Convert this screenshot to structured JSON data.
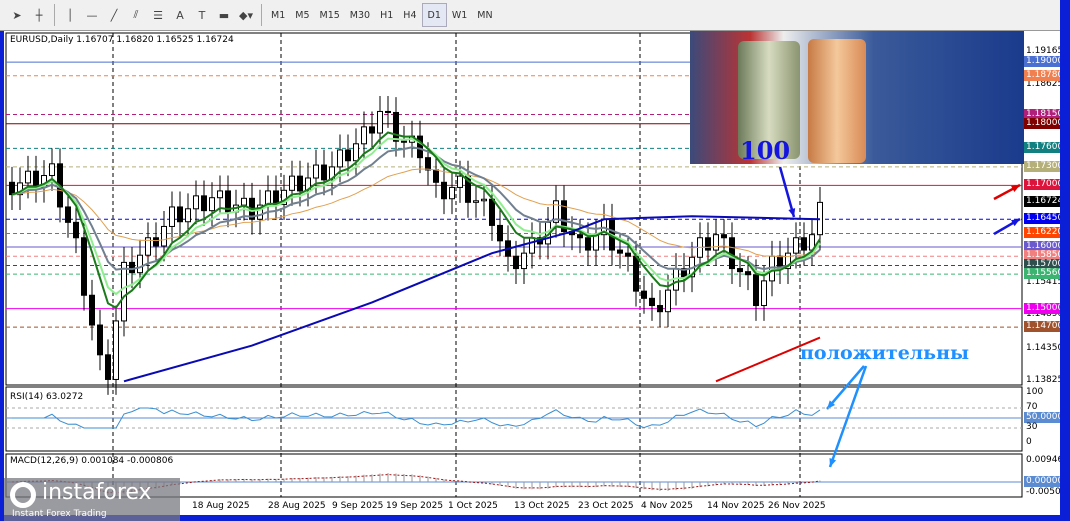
{
  "toolbar": {
    "tools": [
      "cursor",
      "crosshair",
      "vertical-line",
      "horizontal-line",
      "trendline",
      "equidistant-channel",
      "fibonacci",
      "text",
      "text-label",
      "rectangle",
      "shapes-menu"
    ],
    "text_tool": "A",
    "timeframes": [
      "M1",
      "M5",
      "M15",
      "M30",
      "H1",
      "H4",
      "D1",
      "W1",
      "MN"
    ],
    "active_timeframe": "D1"
  },
  "chart": {
    "header": "EURUSD,Daily  1.16707 1.16820 1.16525 1.16724",
    "price_ticks": [
      "1.19165",
      "1.18625",
      "1.15415",
      "1.14890",
      "1.14350",
      "1.13825"
    ],
    "levels": [
      {
        "label": "1.19000",
        "value": 1.19,
        "color": "#4a6fd0",
        "style": "solid"
      },
      {
        "label": "1.18780",
        "value": 1.1878,
        "color": "#f08050",
        "style": "dashed"
      },
      {
        "label": "1.18150",
        "value": 1.1815,
        "color": "#b0207a",
        "style": "dashed"
      },
      {
        "label": "1.18000",
        "value": 1.18,
        "color": "#800000",
        "style": "solid"
      },
      {
        "label": "1.17600",
        "value": 1.176,
        "color": "#128080",
        "style": "dashed"
      },
      {
        "label": "1.17300",
        "value": 1.173,
        "color": "#b5b07a",
        "style": "dashed"
      },
      {
        "label": "1.17000",
        "value": 1.17,
        "color": "#dc143c",
        "style": "solid"
      },
      {
        "label": "1.16724",
        "value": 1.16724,
        "color": "#000000",
        "style": "none"
      },
      {
        "label": "1.16450",
        "value": 1.1645,
        "color": "#0000ee",
        "style": "dashed"
      },
      {
        "label": "1.16220",
        "value": 1.1622,
        "color": "#ff4500",
        "style": "dashed"
      },
      {
        "label": "1.16000",
        "value": 1.16,
        "color": "#6a5acd",
        "style": "solid"
      },
      {
        "label": "1.15850",
        "value": 1.1585,
        "color": "#f08080",
        "style": "dashed"
      },
      {
        "label": "1.15700",
        "value": 1.157,
        "color": "#2f4f4f",
        "style": "dashed"
      },
      {
        "label": "1.15560",
        "value": 1.1556,
        "color": "#3cb371",
        "style": "dashed"
      },
      {
        "label": "1.15000",
        "value": 1.15,
        "color": "#ee00ee",
        "style": "solid"
      },
      {
        "label": "1.14700",
        "value": 1.147,
        "color": "#a0522d",
        "style": "dashed"
      }
    ],
    "dates": [
      "18 Aug 2025",
      "28 Aug 2025",
      "9 Sep 2025",
      "19 Sep 2025",
      "1 Oct 2025",
      "13 Oct 2025",
      "23 Oct 2025",
      "4 Nov 2025",
      "14 Nov 2025",
      "26 Nov 2025"
    ],
    "annotation_100": "100",
    "annotation_positive": "положительны"
  },
  "rsi": {
    "header": "RSI(14) 63.0272",
    "ticks": [
      "100",
      "70",
      "50.0000",
      "30",
      "0"
    ]
  },
  "macd": {
    "header": "MACD(12,26,9) 0.001084 -0.000806",
    "ticks": [
      "0.009462",
      "0.000000",
      "-0.005075"
    ]
  },
  "watermark": {
    "brand": "instaforex",
    "tagline": "Instant Forex Trading"
  },
  "chart_data": {
    "type": "candlestick",
    "symbol": "EURUSD",
    "timeframe": "Daily",
    "ylim": [
      1.13825,
      1.19165
    ],
    "close_keyframes": [
      [
        0,
        1.17
      ],
      [
        5,
        1.172
      ],
      [
        8,
        1.16
      ],
      [
        11,
        1.141
      ],
      [
        12,
        1.14
      ],
      [
        14,
        1.156
      ],
      [
        17,
        1.16
      ],
      [
        20,
        1.165
      ],
      [
        25,
        1.168
      ],
      [
        30,
        1.166
      ],
      [
        35,
        1.17
      ],
      [
        40,
        1.173
      ],
      [
        44,
        1.178
      ],
      [
        46,
        1.182
      ],
      [
        49,
        1.177
      ],
      [
        51,
        1.176
      ],
      [
        53,
        1.169
      ],
      [
        56,
        1.17
      ],
      [
        60,
        1.165
      ],
      [
        62,
        1.157
      ],
      [
        65,
        1.16
      ],
      [
        68,
        1.166
      ],
      [
        71,
        1.16
      ],
      [
        74,
        1.163
      ],
      [
        77,
        1.157
      ],
      [
        80,
        1.149
      ],
      [
        83,
        1.155
      ],
      [
        86,
        1.16
      ],
      [
        88,
        1.162
      ],
      [
        91,
        1.156
      ],
      [
        93,
        1.152
      ],
      [
        95,
        1.157
      ],
      [
        98,
        1.16
      ],
      [
        100,
        1.162
      ],
      [
        101,
        1.16724
      ]
    ],
    "ma100_keyframes": [
      [
        14,
        1.1382
      ],
      [
        30,
        1.144
      ],
      [
        45,
        1.151
      ],
      [
        60,
        1.159
      ],
      [
        70,
        1.1625
      ],
      [
        74,
        1.1645
      ],
      [
        85,
        1.165
      ],
      [
        101,
        1.1645
      ]
    ],
    "trendline": [
      [
        88,
        1.1382
      ],
      [
        101,
        1.1453
      ]
    ],
    "rsi_last": 63.0272,
    "macd_last": [
      0.001084,
      -0.000806
    ]
  }
}
